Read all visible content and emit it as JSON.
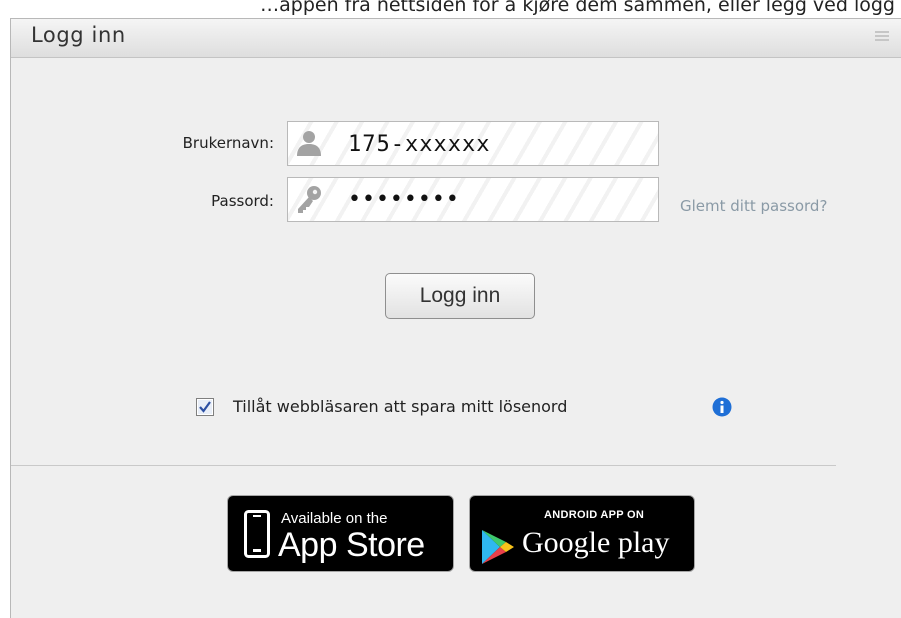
{
  "top_strip_text": "…appen fra nettsiden for å kjøre dem sammen, eller legg ved logg",
  "panel": {
    "title": "Logg inn"
  },
  "form": {
    "username_label": "Brukernavn:",
    "username_value": "175-xxxxxx",
    "password_label": "Passord:",
    "password_display": "••••••••",
    "forgot_link": "Glemt ditt passord?",
    "login_button": "Logg inn",
    "remember_label": "Tillåt webbläsaren att spara mitt lösenord",
    "remember_checked": true
  },
  "badges": {
    "appstore_small": "Available on the",
    "appstore_big": "App Store",
    "googleplay_small": "ANDROID APP ON",
    "googleplay_big": "Google play"
  },
  "colors": {
    "link": "#8a9aa6",
    "info_icon": "#1f6fd6",
    "panel_bg": "#efefef"
  }
}
